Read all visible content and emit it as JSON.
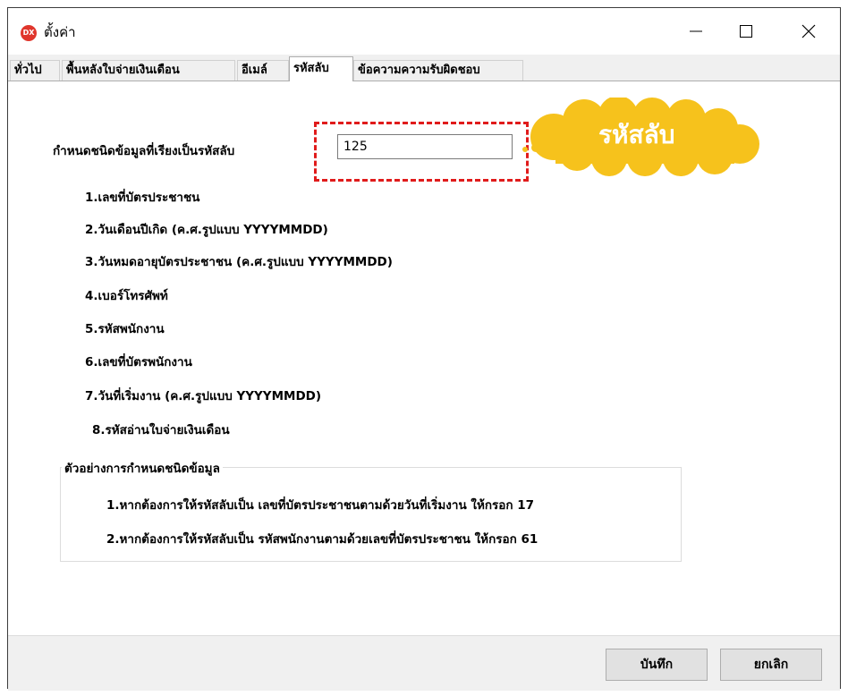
{
  "window": {
    "title": "ตั้งค่า",
    "app_icon_text": "DX"
  },
  "tabs": [
    {
      "label": "ทั่วไป"
    },
    {
      "label": "พื้นหลังใบจ่ายเงินเดือน"
    },
    {
      "label": "อีเมล์"
    },
    {
      "label": "รหัสลับ",
      "active": true
    },
    {
      "label": "ข้อความความรับผิดชอบ"
    }
  ],
  "password": {
    "field_label": "กำหนดชนิดข้อมูลที่เรียงเป็นรหัสลับ",
    "value": "125",
    "callout": "รหัสลับ",
    "options": [
      "1.เลขที่บัตรประชาชน",
      "2.วันเดือนปีเกิด (ค.ศ.รูปแบบ YYYYMMDD)",
      "3.วันหมดอายุบัตรประชาชน (ค.ศ.รูปแบบ YYYYMMDD)",
      "4.เบอร์โทรศัพท์",
      "5.รหัสพนักงาน",
      "6.เลขที่บัตรพนักงาน",
      "7.วันที่เริ่มงาน (ค.ศ.รูปแบบ YYYYMMDD)",
      "8.รหัสอ่านใบจ่ายเงินเดือน"
    ]
  },
  "examples": {
    "title": "ตัวอย่างการกำหนดชนิดข้อมูล",
    "items": [
      "1.หากต้องการให้รหัสลับเป็น เลขที่บัตรประชาชนตามด้วยวันที่เริ่มงาน ให้กรอก 17",
      "2.หากต้องการให้รหัสลับเป็น รหัสพนักงานตามด้วยเลขที่บัตรประชาชน ให้กรอก 61"
    ]
  },
  "buttons": {
    "save": "บันทึก",
    "cancel": "ยกเลิก"
  },
  "colors": {
    "callout": "#f6c21c",
    "highlight_border": "#e01b1b",
    "app_icon": "#e0362c"
  },
  "icons": [
    "app-logo-icon",
    "minimize-icon",
    "maximize-icon",
    "close-icon"
  ]
}
